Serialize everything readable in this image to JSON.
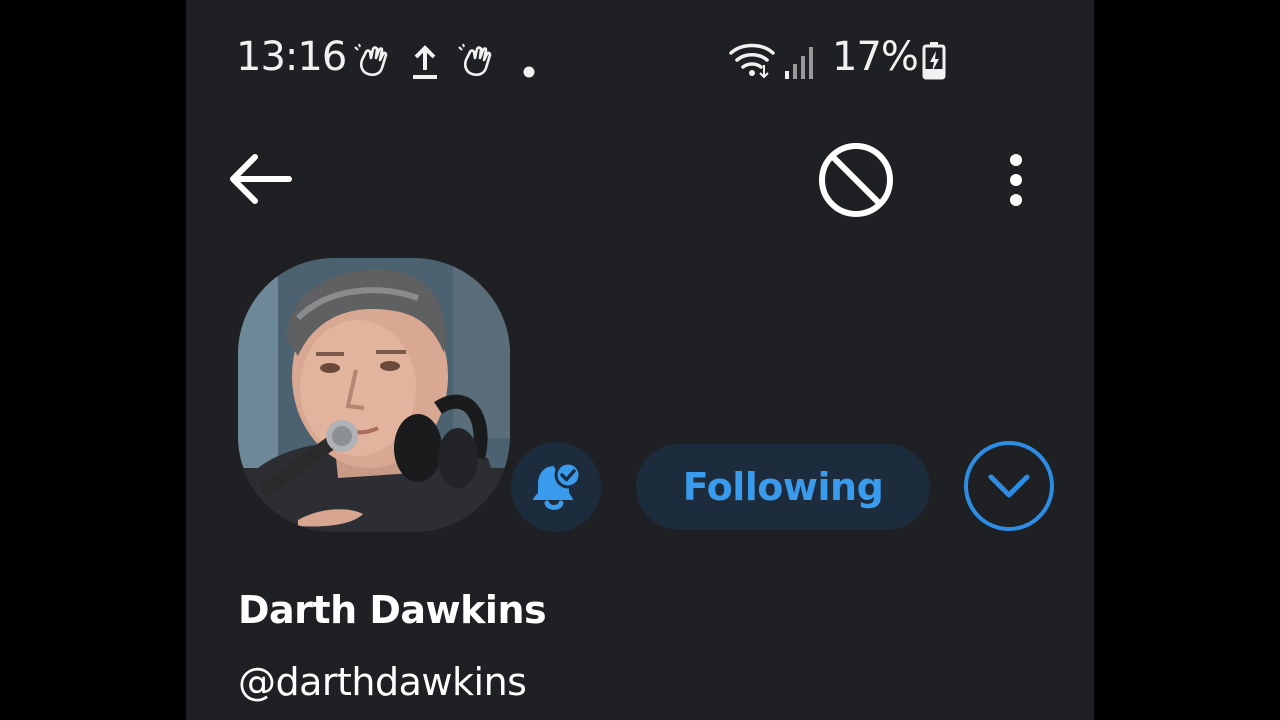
{
  "status_bar": {
    "time": "13:16",
    "battery_percent": "17%",
    "notification_icons": [
      "wave-hand-icon",
      "upload-icon",
      "wave-hand-icon",
      "dot-icon"
    ],
    "system_icons": [
      "wifi-icon",
      "signal-icon",
      "battery-charging-icon"
    ]
  },
  "top_bar": {
    "back_icon": "arrow-left-icon",
    "block_icon": "block-icon",
    "menu_icon": "more-vertical-icon"
  },
  "profile": {
    "display_name": "Darth Dawkins",
    "handle": "@darthdawkins",
    "following_label": "Following",
    "notification_icon": "bell-check-icon",
    "dropdown_icon": "chevron-down-icon"
  },
  "colors": {
    "background": "#1f2023",
    "accent": "#3a9bec",
    "button_fill": "#1d2c3d"
  }
}
